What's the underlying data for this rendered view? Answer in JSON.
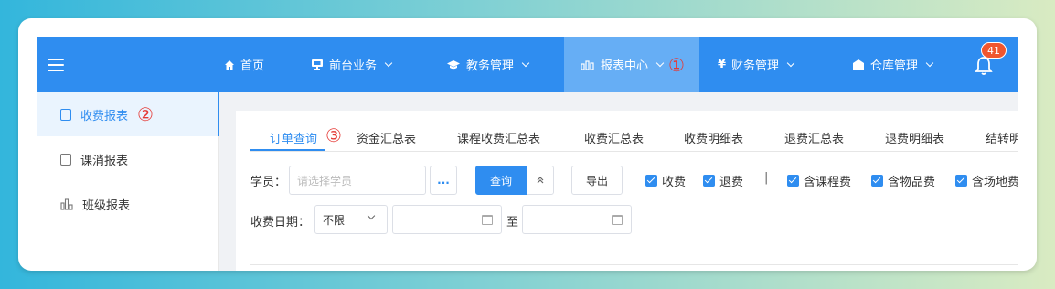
{
  "colors": {
    "primary": "#2f8df0",
    "active_nav": "#66aef5",
    "annotation": "#e53935",
    "badge": "#f0562f"
  },
  "nav": {
    "items": [
      {
        "label": "首页",
        "icon": "home-icon"
      },
      {
        "label": "前台业务",
        "icon": "monitor-icon"
      },
      {
        "label": "教务管理",
        "icon": "graduation-cap-icon"
      },
      {
        "label": "报表中心",
        "icon": "bar-chart-icon",
        "active": true
      },
      {
        "label": "财务管理",
        "icon": "yen-icon"
      },
      {
        "label": "仓库管理",
        "icon": "warehouse-icon"
      }
    ],
    "notification_count": "41"
  },
  "annotations": {
    "one": "①",
    "two": "②",
    "three": "③"
  },
  "sidebar": {
    "items": [
      {
        "label": "收费报表",
        "active": true
      },
      {
        "label": "课消报表"
      },
      {
        "label": "班级报表"
      }
    ]
  },
  "tabs": [
    "订单查询",
    "资金汇总表",
    "课程收费汇总表",
    "收费汇总表",
    "收费明细表",
    "退费汇总表",
    "退费明细表",
    "结转明"
  ],
  "filters": {
    "student_label": "学员：",
    "student_placeholder": "请选择学员",
    "more_label": "...",
    "query_label": "查询",
    "export_label": "导出",
    "checkboxes": [
      "收费",
      "退费",
      "含课程费",
      "含物品费",
      "含场地费"
    ],
    "separator": "|",
    "date_label": "收费日期：",
    "date_range_value": "不限",
    "to_label": "至"
  }
}
